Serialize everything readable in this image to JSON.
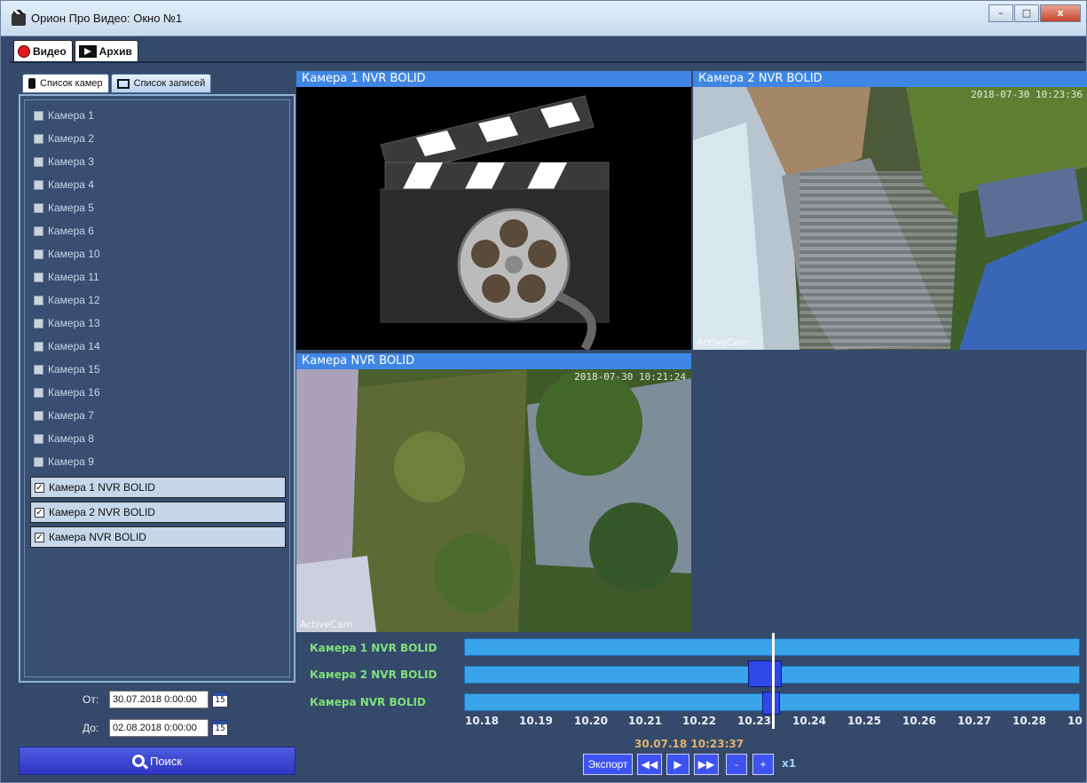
{
  "window": {
    "title": "Орион Про Видео: Окно №1",
    "btn_min": "–",
    "btn_max": "□",
    "btn_close": "x"
  },
  "main_tabs": [
    {
      "label": "Видео"
    },
    {
      "label": "Архив"
    }
  ],
  "left": {
    "tabs": [
      {
        "label": "Список камер"
      },
      {
        "label": "Список записей"
      }
    ],
    "cameras": [
      "Камера 1",
      "Камера 2",
      "Камера 3",
      "Камера 4",
      "Камера 5",
      "Камера 6",
      "Камера 10",
      "Камера 11",
      "Камера 12",
      "Камера 13",
      "Камера 14",
      "Камера 15",
      "Камера 16",
      "Камера 7",
      "Камера 8",
      "Камера 9"
    ],
    "selected_cameras": [
      "Камера 1 NVR BOLID",
      "Камера 2 NVR BOLID",
      "Камера NVR BOLID"
    ],
    "check_mark": "✓",
    "from_label": "От:",
    "from_value": "30.07.2018 0:00:00",
    "to_label": "До:",
    "to_value": "02.08.2018 0:00:00",
    "cal_day": "15",
    "search_label": "Поиск"
  },
  "tiles": [
    {
      "title": "Камера 1 NVR BOLID",
      "timestamp": "",
      "watermark": ""
    },
    {
      "title": "Камера 2 NVR BOLID",
      "timestamp": "2018-07-30 10:23:36",
      "watermark": "ActiveCam"
    },
    {
      "title": "Камера NVR BOLID",
      "timestamp": "2018-07-30 10:21:24",
      "watermark": "ActiveCam"
    }
  ],
  "timeline": {
    "rows": [
      "Камера 1 NVR BOLID",
      "Камера 2 NVR BOLID",
      "Камера NVR BOLID"
    ],
    "ticks": [
      "10.18",
      "10.19",
      "10.20",
      "10.21",
      "10.22",
      "10.23",
      "10.24",
      "10.25",
      "10.26",
      "10.27",
      "10.28",
      "10"
    ],
    "current_time": "30.07.18 10:23:37",
    "export_label": "Экспорт",
    "rewind": "◀◀",
    "play": "▶",
    "forward": "▶▶",
    "minus": "-",
    "plus": "+",
    "speed": "x1"
  },
  "colors": {
    "accent": "#3f86e6",
    "timeline_track": "#3aa4ea",
    "timeline_block": "#2f47e8",
    "label_green": "#7fe07a",
    "time_orange": "#e0b070"
  }
}
